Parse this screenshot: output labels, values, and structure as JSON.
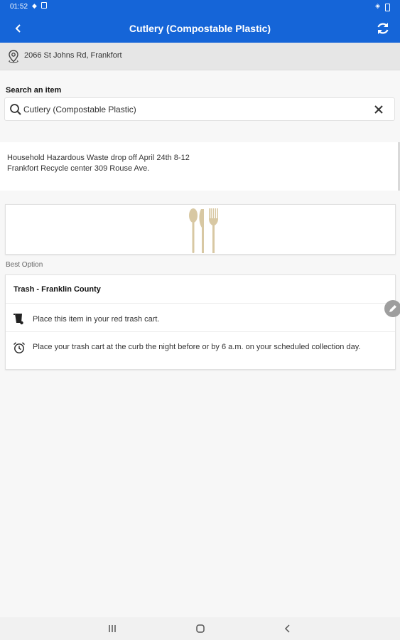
{
  "status_bar": {
    "time": "01:52"
  },
  "app_bar": {
    "title": "Cutlery (Compostable Plastic)"
  },
  "location": {
    "address": "2066 St Johns Rd, Frankfort"
  },
  "search": {
    "label": "Search an item",
    "value": "Cutlery (Compostable Plastic)",
    "placeholder": ""
  },
  "announcement": {
    "line1": "Household Hazardous Waste drop off April 24th 8-12",
    "line2": "Frankfort Recycle center 309 Rouse Ave."
  },
  "best_option": {
    "label": "Best Option",
    "title": "Trash - Franklin County",
    "instructions": [
      {
        "icon": "trash-cart-icon",
        "text": "Place this item in your red trash cart."
      },
      {
        "icon": "alarm-clock-icon",
        "text": "Place your trash cart at the curb the night before or by 6 a.m. on your scheduled collection day."
      }
    ]
  },
  "colors": {
    "primary": "#1565d8",
    "background": "#f7f7f7",
    "location_bar": "#e6e6e6"
  }
}
